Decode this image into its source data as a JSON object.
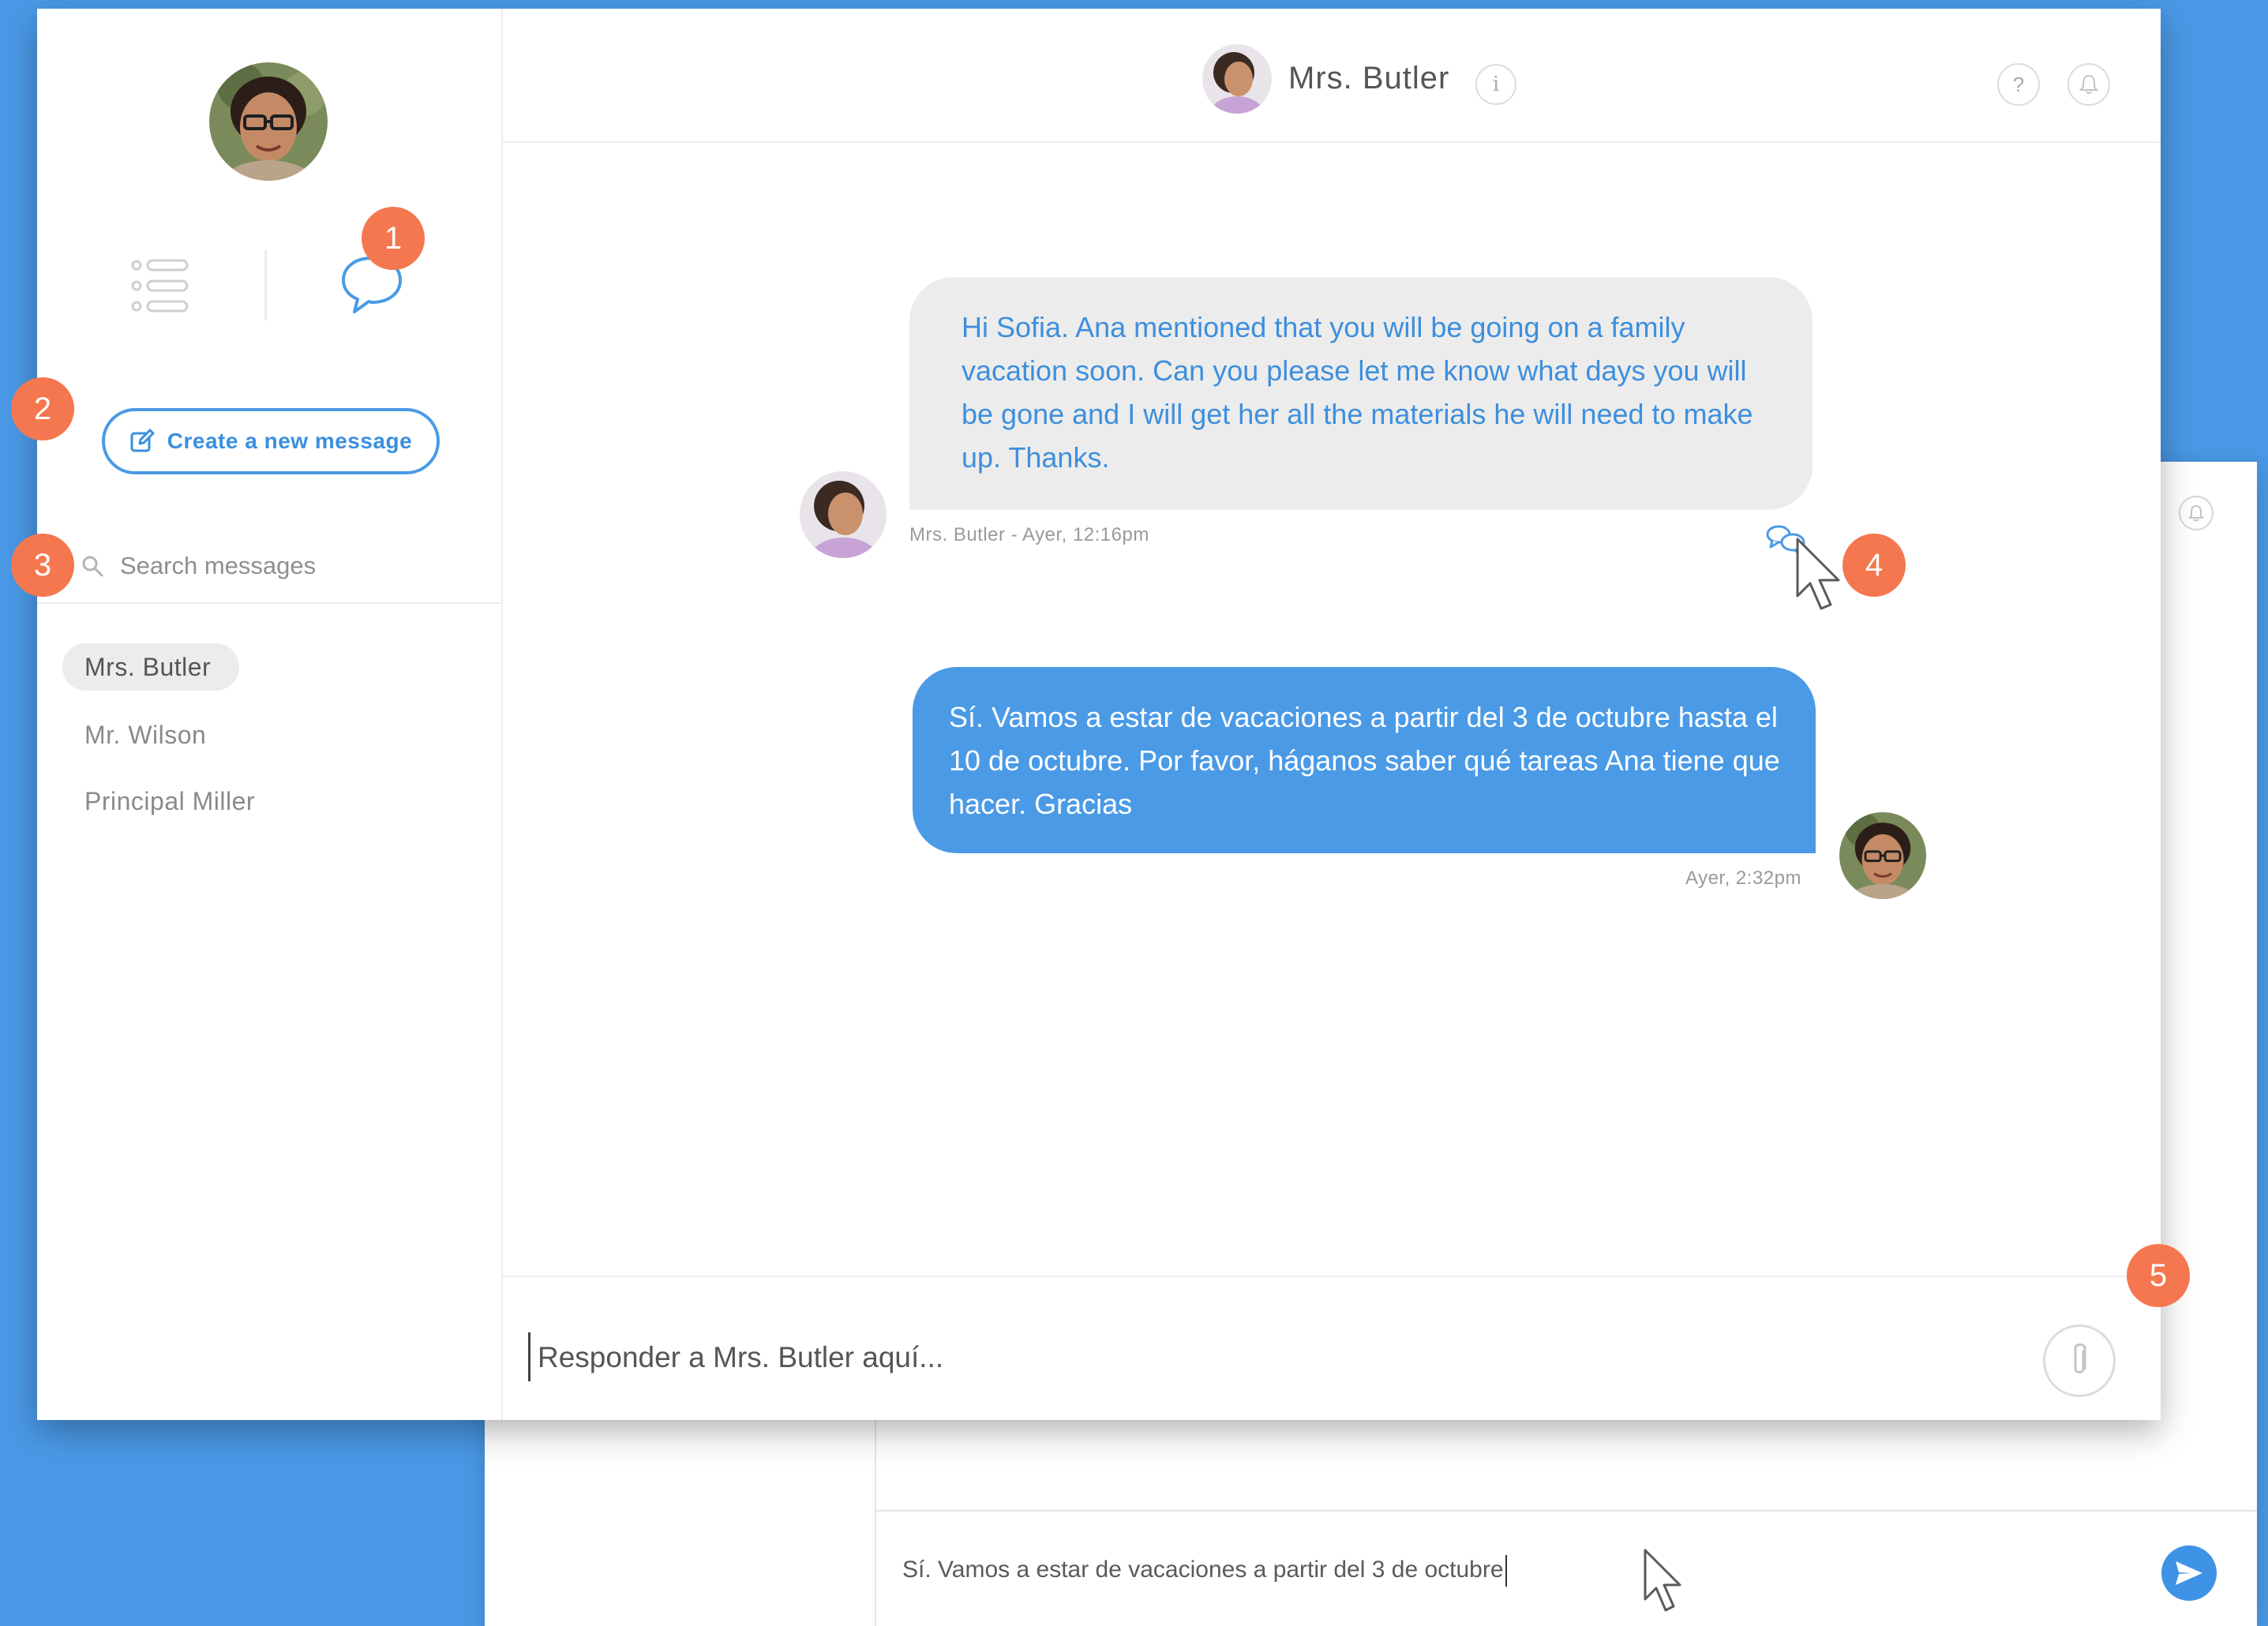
{
  "colors": {
    "brand_blue": "#4a9ae6",
    "badge_orange": "#f5774f",
    "page_background": "#4a99e6"
  },
  "sidebar": {
    "nav": [
      {
        "icon": "list-icon"
      },
      {
        "icon": "chat-bubble-icon"
      }
    ],
    "new_message_label": "Create a new message",
    "search_placeholder": "Search messages",
    "contacts": [
      {
        "name": "Mrs. Butler",
        "active": true
      },
      {
        "name": "Mr. Wilson",
        "active": false
      },
      {
        "name": "Principal Miller",
        "active": false
      }
    ]
  },
  "header": {
    "title": "Mrs. Butler",
    "info_label": "i",
    "help_label": "?"
  },
  "messages": [
    {
      "direction": "incoming",
      "text": "Hi Sofia. Ana mentioned that you will be going on a family vacation soon. Can you please let me know what days you will be gone and I will get her all the materials he will need to make up. Thanks.",
      "meta": "Mrs. Butler - Ayer, 12:16pm"
    },
    {
      "direction": "outgoing",
      "text": "Sí. Vamos a estar de vacaciones a partir del 3 de octubre hasta el 10 de octubre. Por favor, háganos saber qué tareas Ana tiene que hacer. Gracias",
      "meta": "Ayer, 2:32pm"
    }
  ],
  "composer": {
    "placeholder": "Responder a Mrs. Butler aquí..."
  },
  "background_window": {
    "input_text": "Sí. Vamos a estar de vacaciones a partir del 3 de octubre"
  },
  "callouts": [
    "1",
    "2",
    "3",
    "4",
    "5"
  ]
}
